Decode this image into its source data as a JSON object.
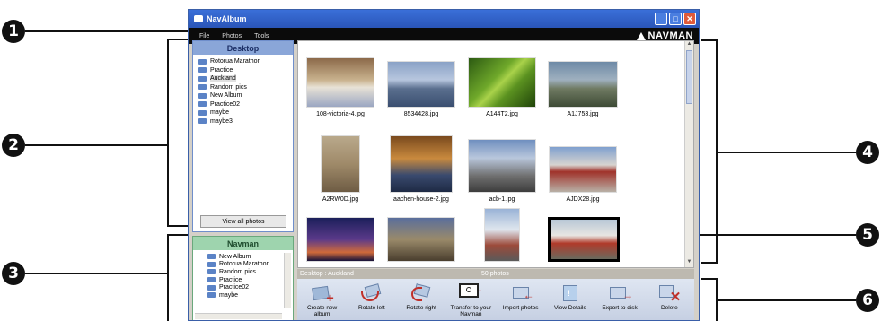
{
  "window": {
    "title": "NavAlbum",
    "menu": [
      "File",
      "Photos",
      "Tools"
    ],
    "brand": "NAVMAN"
  },
  "callouts": [
    "1",
    "2",
    "3",
    "4",
    "5",
    "6"
  ],
  "desktop_panel": {
    "title": "Desktop",
    "folders": [
      "Rotorua Marathon",
      "Practice",
      "Auckland",
      "Random pics",
      "New Album",
      "Practice02",
      "maybe",
      "maybe3"
    ],
    "selected_folder": "Auckland",
    "view_all_label": "View all photos"
  },
  "navman_panel": {
    "title": "Navman",
    "folders": [
      "New Album",
      "Rotorua Marathon",
      "Random pics",
      "Practice",
      "Practice02",
      "maybe"
    ]
  },
  "photos": [
    {
      "name": "108-victoria-4.jpg",
      "scene": "bedroom"
    },
    {
      "name": "8534428.jpg",
      "scene": "city"
    },
    {
      "name": "A144T2.jpg",
      "scene": "leaf"
    },
    {
      "name": "A1J753.jpg",
      "scene": "cemetery"
    },
    {
      "name": "A2RW0D.jpg",
      "scene": "meerkat"
    },
    {
      "name": "aachen-house-2.jpg",
      "scene": "interior"
    },
    {
      "name": "acb-1.jpg",
      "scene": "building"
    },
    {
      "name": "AJDX28.jpg",
      "scene": "house"
    },
    {
      "name": "",
      "scene": "sunset"
    },
    {
      "name": "",
      "scene": "street"
    },
    {
      "name": "",
      "scene": "tower"
    },
    {
      "name": "",
      "scene": "storefront",
      "selected": true
    }
  ],
  "status": {
    "path": "Desktop : Auckland",
    "count": "50 photos"
  },
  "toolbar": [
    {
      "label": "Create new album",
      "icon": "new-album-icon"
    },
    {
      "label": "Rotate left",
      "icon": "rotate-left-icon"
    },
    {
      "label": "Rotate right",
      "icon": "rotate-right-icon"
    },
    {
      "label": "Transfer to your Navman",
      "icon": "transfer-icon"
    },
    {
      "label": "Import photos",
      "icon": "import-icon"
    },
    {
      "label": "View Details",
      "icon": "details-icon"
    },
    {
      "label": "Export to disk",
      "icon": "export-icon"
    },
    {
      "label": "Delete",
      "icon": "delete-icon"
    }
  ]
}
